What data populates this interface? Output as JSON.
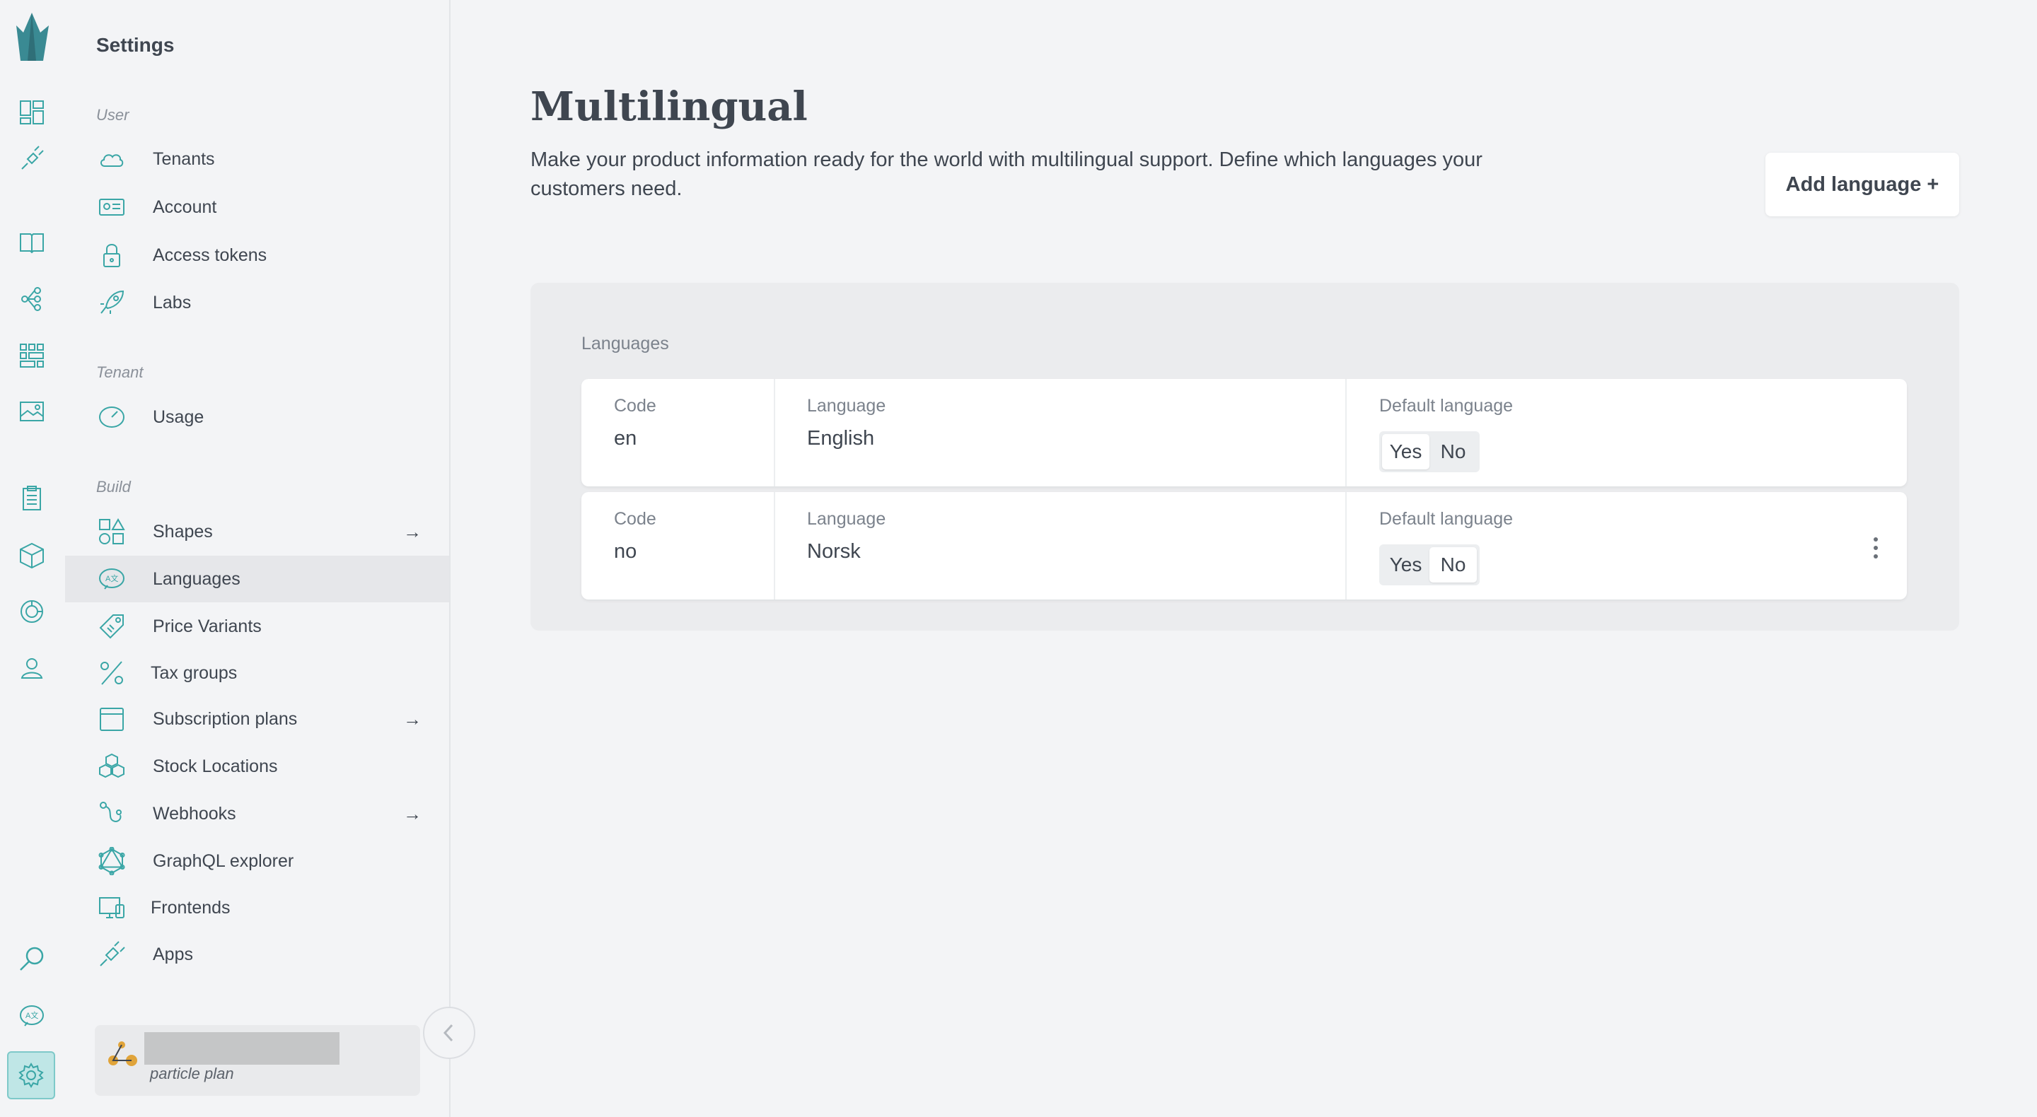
{
  "sidebar": {
    "title": "Settings",
    "groups": [
      {
        "label": "User"
      },
      {
        "label": "Tenant"
      },
      {
        "label": "Build"
      }
    ],
    "items": [
      {
        "label": "Tenants",
        "icon": "cloud-icon"
      },
      {
        "label": "Account",
        "icon": "id-card-icon"
      },
      {
        "label": "Access tokens",
        "icon": "lock-icon"
      },
      {
        "label": "Labs",
        "icon": "rocket-icon"
      },
      {
        "label": "Usage",
        "icon": "gauge-icon"
      },
      {
        "label": "Shapes",
        "icon": "shapes-icon",
        "arrow": "→"
      },
      {
        "label": "Languages",
        "icon": "translate-icon",
        "active": true
      },
      {
        "label": "Price Variants",
        "icon": "price-tag-icon"
      },
      {
        "label": "Tax groups",
        "icon": "percent-icon"
      },
      {
        "label": "Subscription plans",
        "icon": "calendar-icon",
        "arrow": "→"
      },
      {
        "label": "Stock Locations",
        "icon": "boxes-icon"
      },
      {
        "label": "Webhooks",
        "icon": "webhook-icon",
        "arrow": "→"
      },
      {
        "label": "GraphQL explorer",
        "icon": "graphql-icon"
      },
      {
        "label": "Frontends",
        "icon": "devices-icon"
      },
      {
        "label": "Apps",
        "icon": "plug-icon"
      }
    ],
    "plan": {
      "subtitle": "particle plan"
    }
  },
  "rail": {
    "icons": [
      "logo-icon",
      "dashboard-icon",
      "plug-icon",
      "catalogue-book-icon",
      "topics-tree-icon",
      "grid-apps-icon",
      "image-gallery-icon",
      "orders-clipboard-icon",
      "product-box-icon",
      "analytics-pie-icon",
      "customers-icon",
      "search-icon",
      "translate-icon",
      "settings-gear-icon"
    ]
  },
  "main": {
    "title": "Multilingual",
    "description": "Make your product information ready for the world with multilingual support. Define which languages your customers need.",
    "add_button": "Add language +",
    "panel_label": "Languages",
    "labels": {
      "code": "Code",
      "language": "Language",
      "default": "Default language",
      "yes": "Yes",
      "no": "No"
    },
    "languages": [
      {
        "code": "en",
        "name": "English",
        "default": "Yes"
      },
      {
        "code": "no",
        "name": "Norsk",
        "default": "No"
      }
    ]
  },
  "colors": {
    "accent": "#3aa6a6",
    "accent_light": "#bfe6e6",
    "text": "#3f4650",
    "muted": "#7b828c",
    "background": "#f3f4f6"
  }
}
